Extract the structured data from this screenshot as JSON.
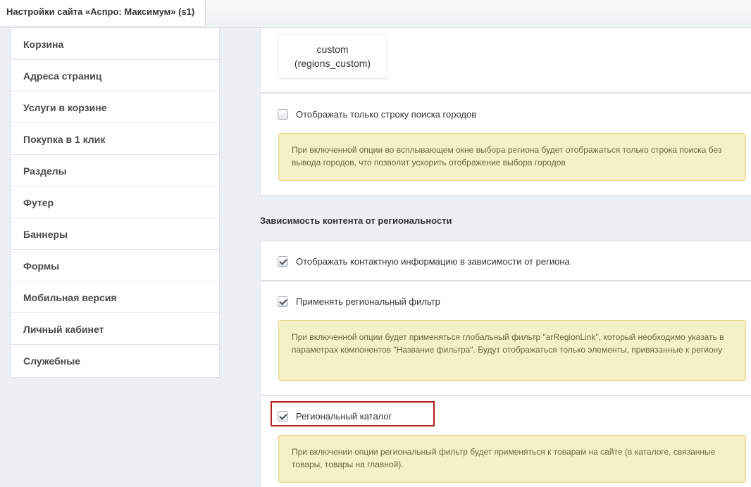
{
  "window": {
    "tab_title": "Настройки сайта «Аспро: Максимум» (s1)"
  },
  "sidebar": {
    "items": [
      {
        "label": "Корзина"
      },
      {
        "label": "Адреса страниц"
      },
      {
        "label": "Услуги в корзине"
      },
      {
        "label": "Покупка в 1 клик"
      },
      {
        "label": "Разделы"
      },
      {
        "label": "Футер"
      },
      {
        "label": "Баннеры"
      },
      {
        "label": "Формы"
      },
      {
        "label": "Мобильная версия"
      },
      {
        "label": "Личный кабинет"
      },
      {
        "label": "Служебные"
      }
    ]
  },
  "main": {
    "template_tile": {
      "line1": "custom",
      "line2": "(regions_custom)"
    },
    "search_only": {
      "label": "Отображать только строку поиска городов",
      "checked": false,
      "note": "При включенной опции во всплывающем окне выбора региона будет отображаться только строка поиска без вывода городов, что позволит ускорить отображение выбора городов"
    },
    "section_title": "Зависимость контента от региональности",
    "contacts": {
      "label": "Отображать контактную информацию в зависимости от региона",
      "checked": true
    },
    "regional_filter": {
      "label": "Применять региональный фильтр",
      "checked": true,
      "note": "При включенной опции будет применяться глобальный фильтр \"arRegionLink\", который необходимо указать в параметрах компонентов \"Название фильтра\". Будут отображаться только элементы, привязанные к региону"
    },
    "regional_catalog": {
      "label": "Региональный каталог",
      "checked": true,
      "note": "При включении опции региональный фильтр будет применяться к товарам на сайте (в каталоге, связанные товары, товары на главной)."
    }
  },
  "colors": {
    "note_background": "#f6f0c6",
    "highlight_border": "#b71c1c"
  }
}
